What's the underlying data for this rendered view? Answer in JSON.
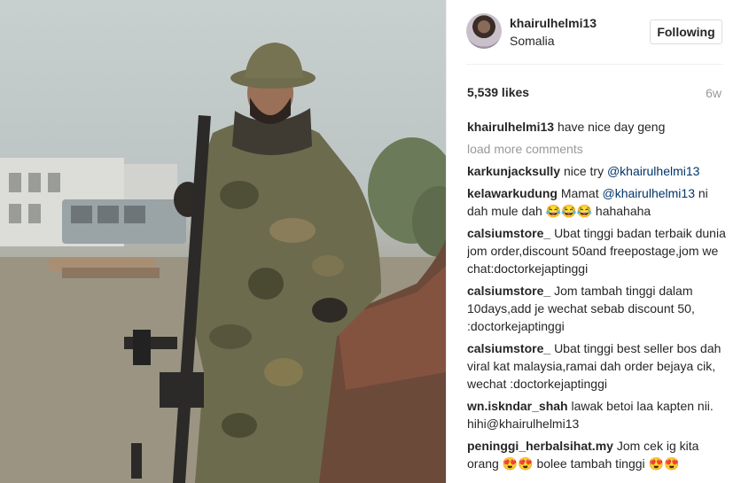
{
  "post": {
    "username": "khairulhelmi13",
    "location": "Somalia",
    "follow_label": "Following",
    "likes": "5,539 likes",
    "time_ago": "6w"
  },
  "comments": {
    "caption": {
      "user": "khairulhelmi13",
      "text": "have nice day geng"
    },
    "load_more": "load more comments",
    "items": [
      {
        "user": "karkunjacksully",
        "text": "nice try",
        "mention": "@khairulhelmi13",
        "after": ""
      },
      {
        "user": "kelawarkudung",
        "text": "Mamat",
        "mention": "@khairulhelmi13",
        "after": "ni dah mule dah 😂😂😂 hahahaha"
      },
      {
        "user": "calsiumstore_",
        "text": "Ubat tinggi badan terbaik dunia jom order,discount 50and freepostage,jom we chat:doctorkejaptinggi",
        "mention": "",
        "after": ""
      },
      {
        "user": "calsiumstore_",
        "text": "Jom tambah tinggi dalam 10days,add je wechat sebab discount 50, :doctorkejaptinggi",
        "mention": "",
        "after": ""
      },
      {
        "user": "calsiumstore_",
        "text": "Ubat tinggi best seller bos dah viral kat malaysia,ramai dah order bejaya cik, wechat :doctorkejaptinggi",
        "mention": "",
        "after": ""
      },
      {
        "user": "wn.iskndar_shah",
        "text": "lawak betoi laa kapten nii. hihi@khairulhelmi13",
        "mention": "",
        "after": ""
      },
      {
        "user": "peninggi_herbalsihat.my",
        "text": "Jom cek ig kita orang 😍😍 bolee tambah tinggi 😍😍",
        "mention": "",
        "after": ""
      }
    ]
  },
  "colors": {
    "text": "#262626",
    "muted": "#999999",
    "mention": "#003569",
    "border": "#dbdbdb"
  }
}
